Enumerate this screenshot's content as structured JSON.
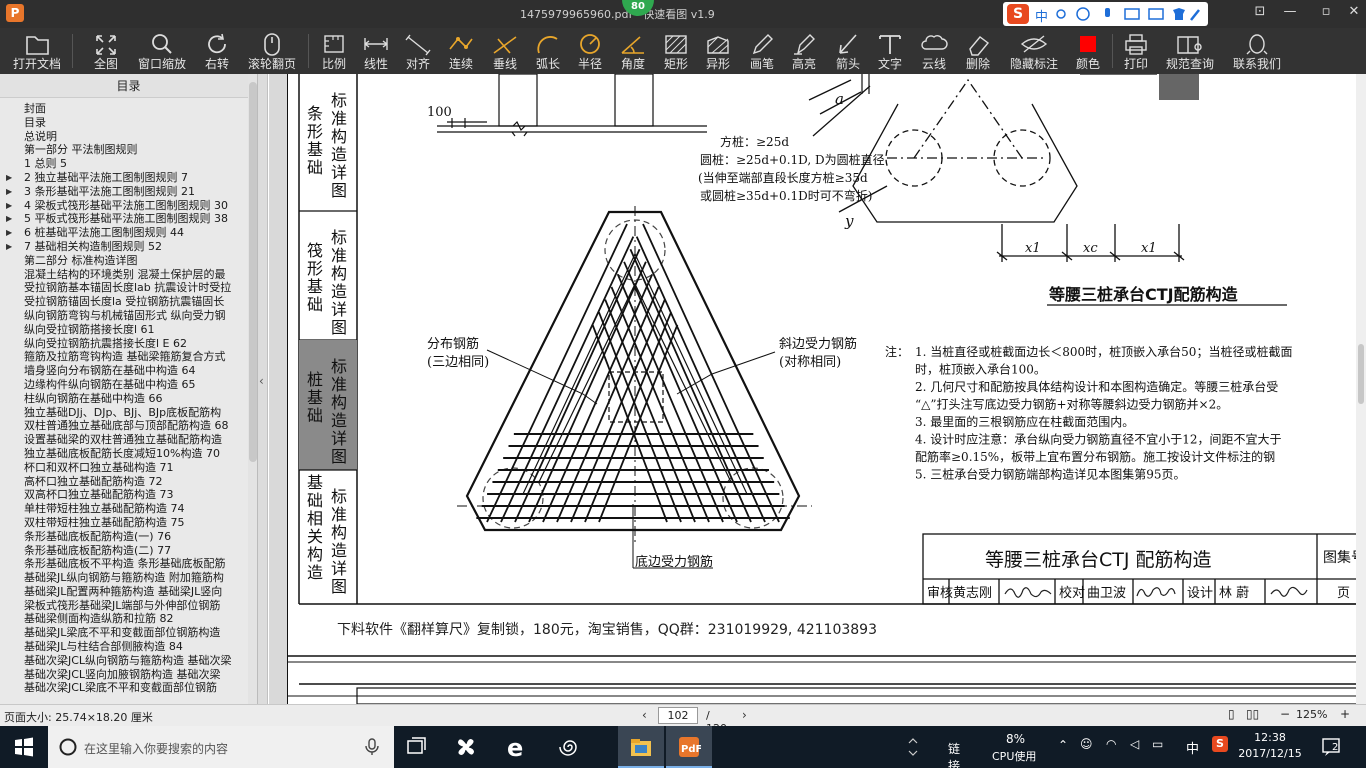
{
  "window": {
    "title": "1475979965960.pdf - 快速看图 v1.9",
    "badge": "80",
    "logo": "P"
  },
  "ime": {
    "lang": "中"
  },
  "toolbar": {
    "open": "打开文档",
    "fit": "全图",
    "window_zoom": "窗口缩放",
    "rotate": "右转",
    "scroll_page": "滚轮翻页",
    "scale": "比例",
    "linear": "线性",
    "aligned": "对齐",
    "continuous": "连续",
    "perpendicular": "垂线",
    "arc_length": "弧长",
    "radius": "半径",
    "angle": "角度",
    "rectangle": "矩形",
    "irregular": "异形",
    "pen": "画笔",
    "highlight": "高亮",
    "arrow": "箭头",
    "text": "文字",
    "cloud": "云线",
    "delete": "删除",
    "hide_marks": "隐藏标注",
    "color": "颜色",
    "print": "打印",
    "spec_query": "规范查询",
    "contact": "联系我们"
  },
  "sidebar": {
    "title": "目录",
    "items": [
      {
        "label": "封面",
        "indent": 1,
        "arrow": false
      },
      {
        "label": "目录",
        "indent": 1,
        "arrow": false
      },
      {
        "label": "总说明",
        "indent": 1,
        "arrow": false
      },
      {
        "label": "第一部分  平法制图规则",
        "indent": 1,
        "arrow": false
      },
      {
        "label": "1 总则 5",
        "indent": 1,
        "arrow": false
      },
      {
        "label": "2 独立基础平法施工图制图规则 7",
        "indent": 1,
        "arrow": true
      },
      {
        "label": "3 条形基础平法施工图制图规则 21",
        "indent": 1,
        "arrow": true
      },
      {
        "label": "4 梁板式筏形基础平法施工图制图规则 30",
        "indent": 1,
        "arrow": true
      },
      {
        "label": "5 平板式筏形基础平法施工图制图规则 38",
        "indent": 1,
        "arrow": true
      },
      {
        "label": "6 桩基础平法施工图制图规则 44",
        "indent": 1,
        "arrow": true
      },
      {
        "label": "7 基础相关构造制图规则 52",
        "indent": 1,
        "arrow": true
      },
      {
        "label": "第二部分  标准构造详图",
        "indent": 1,
        "arrow": false
      },
      {
        "label": "混凝土结构的环境类别 混凝土保护层的最",
        "indent": 1,
        "arrow": false
      },
      {
        "label": "受拉钢筋基本锚固长度lab 抗震设计时受拉",
        "indent": 1,
        "arrow": false
      },
      {
        "label": "受拉钢筋锚固长度la 受拉钢筋抗震锚固长",
        "indent": 1,
        "arrow": false
      },
      {
        "label": "纵向钢筋弯钩与机械锚固形式 纵向受力钢",
        "indent": 1,
        "arrow": false
      },
      {
        "label": "纵向受拉钢筋搭接长度l 61",
        "indent": 1,
        "arrow": false
      },
      {
        "label": "纵向受拉钢筋抗震搭接长度l E 62",
        "indent": 1,
        "arrow": false
      },
      {
        "label": "箍筋及拉筋弯钩构造 基础梁箍筋复合方式",
        "indent": 1,
        "arrow": false
      },
      {
        "label": "墙身竖向分布钢筋在基础中构造 64",
        "indent": 1,
        "arrow": false
      },
      {
        "label": "边缘构件纵向钢筋在基础中构造 65",
        "indent": 1,
        "arrow": false
      },
      {
        "label": "柱纵向钢筋在基础中构造 66",
        "indent": 1,
        "arrow": false
      },
      {
        "label": "独立基础DJj、DJp、BJj、BJp底板配筋构",
        "indent": 1,
        "arrow": false
      },
      {
        "label": "双柱普通独立基础底部与顶部配筋构造 68",
        "indent": 1,
        "arrow": false
      },
      {
        "label": "设置基础梁的双柱普通独立基础配筋构造",
        "indent": 1,
        "arrow": false
      },
      {
        "label": "独立基础底板配筋长度减短10%构造 70",
        "indent": 1,
        "arrow": false
      },
      {
        "label": "杯口和双杯口独立基础构造 71",
        "indent": 1,
        "arrow": false
      },
      {
        "label": "高杯口独立基础配筋构造 72",
        "indent": 1,
        "arrow": false
      },
      {
        "label": "双高杯口独立基础配筋构造 73",
        "indent": 1,
        "arrow": false
      },
      {
        "label": "单柱带短柱独立基础配筋构造 74",
        "indent": 1,
        "arrow": false
      },
      {
        "label": "双柱带短柱独立基础配筋构造 75",
        "indent": 1,
        "arrow": false
      },
      {
        "label": "条形基础底板配筋构造(一) 76",
        "indent": 1,
        "arrow": false
      },
      {
        "label": "条形基础底板配筋构造(二) 77",
        "indent": 1,
        "arrow": false
      },
      {
        "label": "条形基础底板不平构造 条形基础底板配筋",
        "indent": 1,
        "arrow": false
      },
      {
        "label": "基础梁JL纵向钢筋与箍筋构造 附加箍筋构",
        "indent": 1,
        "arrow": false
      },
      {
        "label": "基础梁JL配置两种箍筋构造 基础梁JL竖向",
        "indent": 1,
        "arrow": false
      },
      {
        "label": "梁板式筏形基础梁JL端部与外伸部位钢筋",
        "indent": 1,
        "arrow": false
      },
      {
        "label": "基础梁侧面构造纵筋和拉筋 82",
        "indent": 1,
        "arrow": false
      },
      {
        "label": "基础梁JL梁底不平和变截面部位钢筋构造",
        "indent": 1,
        "arrow": false
      },
      {
        "label": "基础梁JL与柱结合部侧腋构造 84",
        "indent": 1,
        "arrow": false
      },
      {
        "label": "基础次梁JCL纵向钢筋与箍筋构造 基础次梁",
        "indent": 1,
        "arrow": false
      },
      {
        "label": "基础次梁JCL竖向加腋钢筋构造 基础次梁",
        "indent": 1,
        "arrow": false
      },
      {
        "label": "基础次梁JCL梁底不平和变截面部位钢筋",
        "indent": 1,
        "arrow": false
      }
    ]
  },
  "doc": {
    "side_tabs": [
      {
        "label": "标准构造详图",
        "sub": "条形基础",
        "active": false
      },
      {
        "label": "标准构造详图",
        "sub": "筏形基础",
        "active": false
      },
      {
        "label": "标准构造详图",
        "sub": "桩基础",
        "active": true
      },
      {
        "label": "标准构造详图",
        "sub": "基础相关构造",
        "active": false
      }
    ],
    "dim_100": "100",
    "pile_notes": [
      "方桩：≥25d",
      "圆桩：≥25d+0.1D, D为圆桩直径",
      "(当伸至端部直段长度方桩≥35d",
      "或圆桩≥35d+0.1D时可不弯折)"
    ],
    "label_distribution": "分布钢筋",
    "label_distribution_sub": "(三边相同)",
    "label_diagonal": "斜边受力钢筋",
    "label_diagonal_sub": "(对称相同)",
    "label_bottom": "底边受力钢筋",
    "dim_a": "a",
    "dim_y": "y",
    "dim_x1": "x1",
    "dim_xc": "xc",
    "dim_x1b": "x1",
    "plan_title": "等腰三桩承台CTJ配筋构造",
    "notes_head": "注：",
    "notes": [
      "1. 当桩直径或桩截面边长＜800时，桩顶嵌入承台50；当桩径或桩截面",
      "   时，桩顶嵌入承台100。",
      "2. 几何尺寸和配筋按具体结构设计和本图构造确定。等腰三桩承台受",
      "   “△”打头注写底边受力钢筋+对称等腰斜边受力钢筋并×2。",
      "3. 最里面的三根钢筋应在柱截面范围内。",
      "4. 设计时应注意：承台纵向受力钢筋直径不宜小于12，间距不宜大于",
      "   配筋率≥0.15%，板带上宜布置分布钢筋。施工按设计文件标注的钢",
      "5. 三桩承台受力钢筋端部构造详见本图集第95页。"
    ],
    "title_block": "等腰三桩承台CTJ 配筋构造",
    "atlas_no": "图集号",
    "page_lbl": "页",
    "sign_row": [
      "审核",
      "黄志刚",
      "校对",
      "曲卫波",
      "设计",
      "林  蔚"
    ],
    "signatures": [
      "黄志刚",
      "曲卫波",
      "林蔚"
    ],
    "ad": "下料软件《翻样算尺》复制锁，180元，淘宝销售，QQ群：231019929, 421103893"
  },
  "status": {
    "page_size": "页面大小: 25.74×18.20 厘米",
    "page": "102",
    "total": "/ 120",
    "zoom": "125%"
  },
  "taskbar": {
    "search_placeholder": "在这里输入你要搜索的内容",
    "tray_link": "链接",
    "cpu_pct": "8%",
    "cpu_lbl": "CPU使用",
    "ime": "中",
    "time": "12:38",
    "date": "2017/12/15",
    "notif": "2"
  },
  "colors": {
    "title_bg": "#2f2f2f",
    "toolbar_bg": "#333333",
    "accent": "#e8762b",
    "taskbar_bg": "#101b26"
  }
}
